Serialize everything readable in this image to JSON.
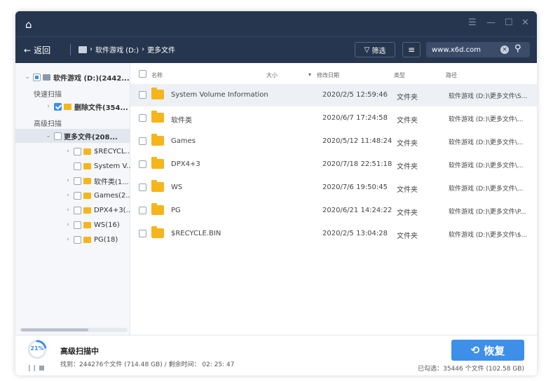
{
  "window": {
    "controls": [
      "⌂",
      "☰",
      "—",
      "☐",
      "✕"
    ]
  },
  "nav": {
    "back_label": "返回",
    "breadcrumb": [
      "软件游戏 (D:)",
      "更多文件"
    ],
    "filter_label": "筛选",
    "search_value": "www.x6d.com"
  },
  "sidebar": {
    "root_label": "软件游戏 (D:)(2442...",
    "quick_scan_label": "快速扫描",
    "deleted_label": "删除文件(354...",
    "deep_scan_label": "高级扫描",
    "more_files_label": "更多文件(208...",
    "children": [
      {
        "label": "$RECYCL..."
      },
      {
        "label": "System V..."
      },
      {
        "label": "软件类(1..."
      },
      {
        "label": "Games(2..."
      },
      {
        "label": "DPX4+3(..."
      },
      {
        "label": "WS(16)"
      },
      {
        "label": "PG(18)"
      }
    ]
  },
  "table": {
    "headers": {
      "name": "名称",
      "size": "大小",
      "modified": "修改日期",
      "type": "类型",
      "path": "路径"
    },
    "rows": [
      {
        "name": "System Volume Information",
        "date": "2020/2/5 12:59:46",
        "type": "文件夹",
        "path": "软件游戏 (D:)\\更多文件\\S..."
      },
      {
        "name": "软件类",
        "date": "2020/6/7 17:24:58",
        "type": "文件夹",
        "path": "软件游戏 (D:)\\更多文件\\..."
      },
      {
        "name": "Games",
        "date": "2020/5/12 11:48:24",
        "type": "文件夹",
        "path": "软件游戏 (D:)\\更多文件\\..."
      },
      {
        "name": "DPX4+3",
        "date": "2020/7/18 22:51:18",
        "type": "文件夹",
        "path": "软件游戏 (D:)\\更多文件\\..."
      },
      {
        "name": "WS",
        "date": "2020/7/6 19:50:45",
        "type": "文件夹",
        "path": "软件游戏 (D:)\\更多文件\\..."
      },
      {
        "name": "PG",
        "date": "2020/6/21 14:24:22",
        "type": "文件夹",
        "path": "软件游戏 (D:)\\更多文件\\P..."
      },
      {
        "name": "$RECYCLE.BIN",
        "date": "2020/2/5 13:04:28",
        "type": "文件夹",
        "path": "软件游戏 (D:)\\更多文件\\$..."
      }
    ]
  },
  "status": {
    "progress_percent": 21,
    "progress_label": "21%",
    "title": "高级扫描中",
    "found_text": "找到：244276个文件 (714.48 GB) / 剩余时间： 02: 25: 47",
    "recover_label": "恢复",
    "selected_text": "已勾选：35446 个文件 (102.58 GB)"
  },
  "colors": {
    "titlebar": "#26364f",
    "accent": "#3d8fe8",
    "folder": "#f5b51b"
  }
}
